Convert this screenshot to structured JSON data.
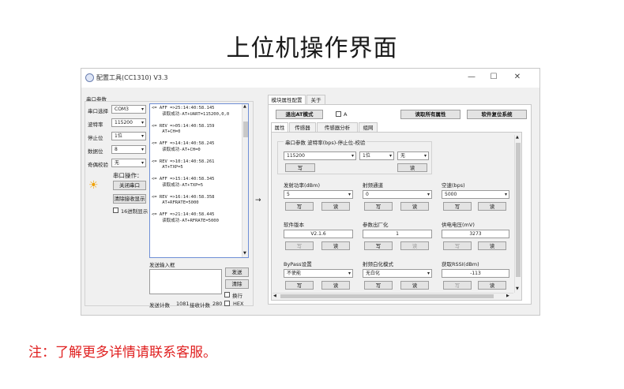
{
  "page": {
    "title": "上位机操作界面",
    "footer_note": "注：了解更多详情请联系客服。"
  },
  "window": {
    "title": "配置工具(CC1310) V3.3",
    "controls": [
      "—",
      "☐",
      "✕"
    ]
  },
  "serial": {
    "group_title": "串口参数",
    "fields": [
      {
        "label": "串口选择",
        "value": "COM3"
      },
      {
        "label": "波特率",
        "value": "115200"
      },
      {
        "label": "停止位",
        "value": "1位"
      },
      {
        "label": "数据位",
        "value": "8"
      },
      {
        "label": "奇偶校验",
        "value": "无"
      }
    ],
    "ops_title": "串口操作：",
    "close_port": "关闭串口",
    "clear_recv": "清除接收显示",
    "hex_display": "16进制显示"
  },
  "log": {
    "lines": [
      "<= AFF =>25:14:40:58.145",
      "    读取成功-AT+UART=115200,0,0",
      "",
      "<= REV =>05:14:40:58.159",
      "    AT+CH=0",
      "",
      "<= AFF =>14:14:40:58.245",
      "    读取成功-AT+CH=0",
      "",
      "<= REV =>10:14:40:58.261",
      "    AT+TXP=5",
      "",
      "<= AFF =>15:14:40:58.345",
      "    读取成功-AT+TXP=5",
      "",
      "<= REV =>16:14:40:58.358",
      "    AT+RFRATE=5000",
      "",
      "<= AFF =>21:14:40:58.445",
      "    读取成功-AT+RFRATE=5000"
    ]
  },
  "send": {
    "title": "发送输入框",
    "send_btn": "发送",
    "clear_btn": "清除",
    "newline": "换行",
    "count_label": "发送计数",
    "send_count": "1081",
    "recv_label": "接收计数",
    "recv_count": "280",
    "hex": "HEX"
  },
  "arrow": "→",
  "right": {
    "tabs": [
      "模块属性配置",
      "关于"
    ],
    "exit_at": "退出AT模式",
    "a_check": "A",
    "read_all": "读取所有属性",
    "reset": "软件复位系统",
    "subtabs": [
      "属性",
      "传感器",
      "传感器分析",
      "组网"
    ],
    "serial_group": "串口参数 波特率(bps)-停止位-校验",
    "baud": "115200",
    "stop": "1位",
    "parity": "无",
    "write": "写",
    "read": "读",
    "tx_power": {
      "label": "发射功率(dBm)",
      "value": "5"
    },
    "channel": {
      "label": "射频通道",
      "value": "0"
    },
    "air_rate": {
      "label": "空速(bps)",
      "value": "5000"
    },
    "version": {
      "label": "软件版本",
      "value": "V2.1.6"
    },
    "param_opt": {
      "label": "参数出厂化",
      "value": "1"
    },
    "voltage": {
      "label": "供电电压(mV)",
      "value": "3273"
    },
    "wakeup": {
      "label": "ByPass设置",
      "value": "不使能"
    },
    "wakeup_mode": {
      "label": "射频白化模式",
      "value": "无白化"
    },
    "rssi": {
      "label": "获取RSSI(dBm)",
      "value": "-113"
    }
  }
}
